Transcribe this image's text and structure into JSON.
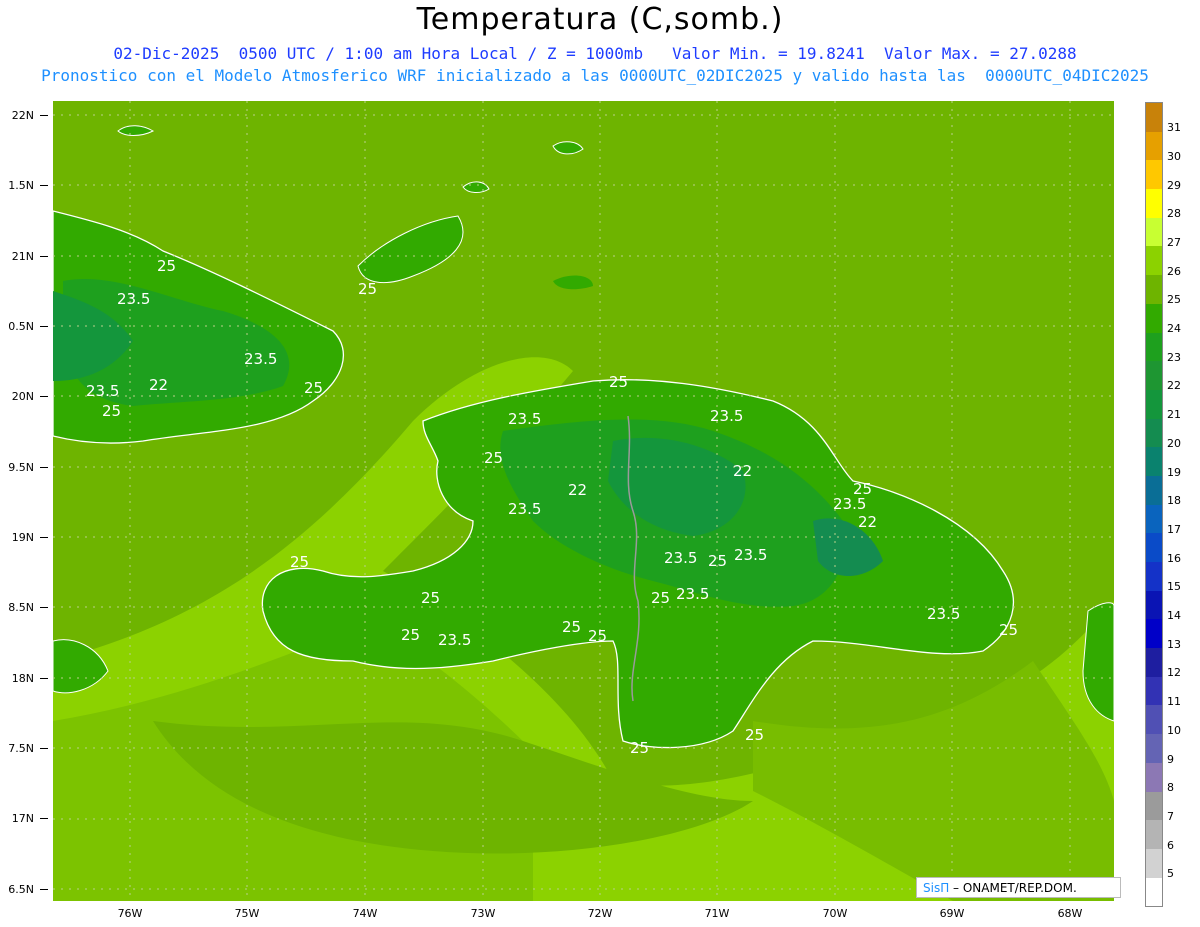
{
  "header": {
    "title": "Temperatura (C,somb.)",
    "line1": "02-Dic-2025  0500 UTC / 1:00 am Hora Local / Z = 1000mb   Valor Min. = 19.8241  Valor Max. = 27.0288",
    "line2": "Pronostico con el Modelo Atmosferico WRF inicializado a las 0000UTC_02DIC2025 y valido hasta las  0000UTC_04DIC2025"
  },
  "axes": {
    "lat_labels": [
      "22N",
      "1.5N",
      "21N",
      "0.5N",
      "20N",
      "9.5N",
      "19N",
      "8.5N",
      "18N",
      "7.5N",
      "17N",
      "6.5N"
    ],
    "lon_labels": [
      "76W",
      "75W",
      "74W",
      "73W",
      "72W",
      "71W",
      "70W",
      "69W",
      "68W"
    ]
  },
  "colorbar": {
    "labels": [
      "31",
      "30",
      "29",
      "28",
      "27",
      "26",
      "25",
      "24",
      "23",
      "22",
      "21",
      "20",
      "19",
      "18",
      "17",
      "16",
      "15",
      "14",
      "13",
      "12",
      "11",
      "10",
      "9",
      "8",
      "7",
      "6",
      "5"
    ],
    "colors": [
      "#c8820a",
      "#e6a000",
      "#ffc800",
      "#ffff00",
      "#c8ff32",
      "#8cd200",
      "#6eb400",
      "#32aa00",
      "#1ea01e",
      "#1e9632",
      "#14963c",
      "#148c50",
      "#0a826e",
      "#0a6e96",
      "#0a64be",
      "#0a4bc8",
      "#1432c8",
      "#0a14b4",
      "#0000c8",
      "#1e1ea0",
      "#3232b4",
      "#5050b4",
      "#6464b4",
      "#8c78b4",
      "#9b9b9b",
      "#b4b4b4",
      "#d2d2d2",
      "#ffffff"
    ]
  },
  "contours": {
    "labels": [
      "25",
      "23.5",
      "23.5",
      "23.5",
      "25",
      "22",
      "25",
      "25",
      "25",
      "23.5",
      "23.5",
      "25",
      "22",
      "22",
      "23.5",
      "25",
      "23.5",
      "22",
      "23.5",
      "23.5",
      "23.5",
      "25",
      "25",
      "25",
      "23.5",
      "25",
      "25",
      "23.5",
      "25",
      "25",
      "25",
      "25"
    ]
  },
  "credit": {
    "brand": "SisΠ",
    "text": " – ONAMET/REP.DOM."
  }
}
